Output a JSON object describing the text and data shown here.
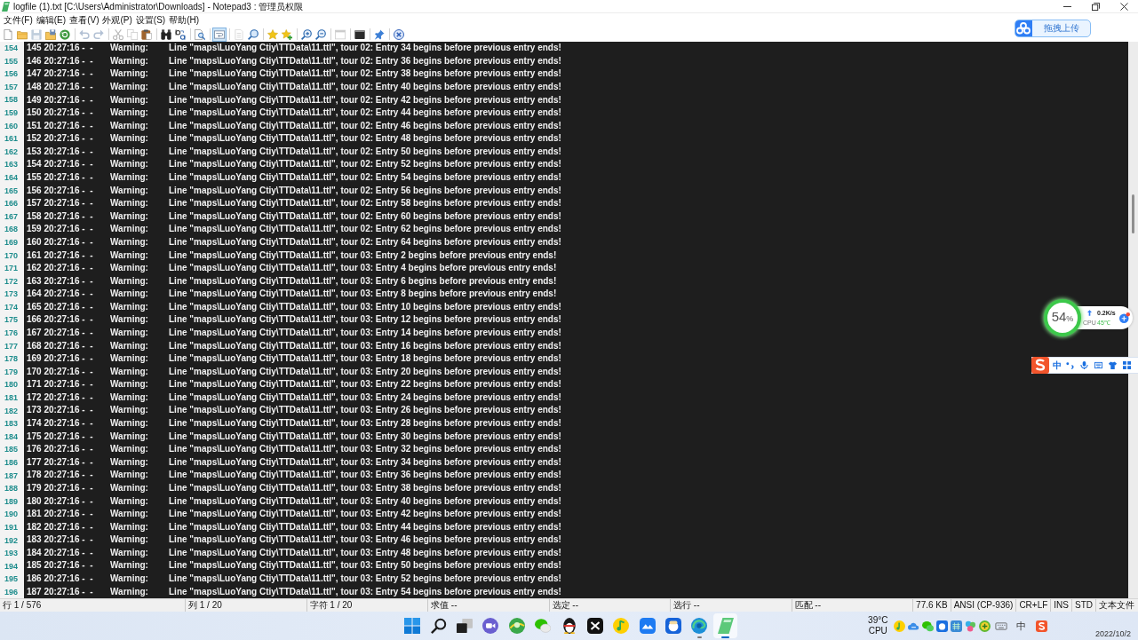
{
  "window": {
    "title": "logfile (1).txt [C:\\Users\\Administrator\\Downloads] - Notepad3 : 管理员权限"
  },
  "menu": [
    "文件(F)",
    "编辑(E)",
    "查看(V)",
    "外观(P)",
    "设置(S)",
    "帮助(H)"
  ],
  "toolbar": [
    {
      "buttons": [
        {
          "kind": "new",
          "disabled": false,
          "selected": false
        },
        {
          "kind": "open",
          "disabled": false,
          "selected": false
        },
        {
          "kind": "save",
          "disabled": true,
          "selected": false
        },
        {
          "kind": "saveas",
          "disabled": false,
          "selected": false
        },
        {
          "kind": "revert",
          "disabled": false,
          "selected": false
        }
      ]
    },
    {
      "buttons": [
        {
          "kind": "undo",
          "disabled": true,
          "selected": false
        },
        {
          "kind": "redo",
          "disabled": true,
          "selected": false
        }
      ]
    },
    {
      "buttons": [
        {
          "kind": "cut",
          "disabled": true,
          "selected": false
        },
        {
          "kind": "copy",
          "disabled": true,
          "selected": false
        },
        {
          "kind": "paste",
          "disabled": false,
          "selected": false
        }
      ]
    },
    {
      "buttons": [
        {
          "kind": "find",
          "disabled": false,
          "selected": false
        },
        {
          "kind": "replace",
          "disabled": false,
          "selected": false
        }
      ]
    },
    {
      "buttons": [
        {
          "kind": "lookup",
          "disabled": false,
          "selected": false
        }
      ]
    },
    {
      "buttons": [
        {
          "kind": "wrap",
          "disabled": false,
          "selected": true
        }
      ]
    },
    {
      "buttons": [
        {
          "kind": "page",
          "disabled": true,
          "selected": false
        },
        {
          "kind": "search",
          "disabled": false,
          "selected": false
        }
      ]
    },
    {
      "buttons": [
        {
          "kind": "star",
          "disabled": false,
          "selected": false
        },
        {
          "kind": "starplus",
          "disabled": false,
          "selected": false
        }
      ]
    },
    {
      "buttons": [
        {
          "kind": "zoomin",
          "disabled": false,
          "selected": false
        },
        {
          "kind": "zoomout",
          "disabled": false,
          "selected": false
        }
      ]
    },
    {
      "buttons": [
        {
          "kind": "window",
          "disabled": true,
          "selected": false
        }
      ]
    },
    {
      "buttons": [
        {
          "kind": "terminal",
          "disabled": false,
          "selected": false
        }
      ]
    },
    {
      "buttons": [
        {
          "kind": "pin",
          "disabled": false,
          "selected": false
        }
      ]
    },
    {
      "buttons": [
        {
          "kind": "close",
          "disabled": false,
          "selected": false
        }
      ]
    }
  ],
  "upload_button": {
    "label": "拖拽上传"
  },
  "editor": {
    "rows": [
      {
        "line_number": "154",
        "head": "145 20:27:16 -  -",
        "severity": "Warning:",
        "message": "Line \"maps\\LuoYang Ctiy\\TTData\\11.ttl\", tour 02: Entry 34 begins before previous entry ends!"
      },
      {
        "line_number": "155",
        "head": "146 20:27:16 -  -",
        "severity": "Warning:",
        "message": "Line \"maps\\LuoYang Ctiy\\TTData\\11.ttl\", tour 02: Entry 36 begins before previous entry ends!"
      },
      {
        "line_number": "156",
        "head": "147 20:27:16 -  -",
        "severity": "Warning:",
        "message": "Line \"maps\\LuoYang Ctiy\\TTData\\11.ttl\", tour 02: Entry 38 begins before previous entry ends!"
      },
      {
        "line_number": "157",
        "head": "148 20:27:16 -  -",
        "severity": "Warning:",
        "message": "Line \"maps\\LuoYang Ctiy\\TTData\\11.ttl\", tour 02: Entry 40 begins before previous entry ends!"
      },
      {
        "line_number": "158",
        "head": "149 20:27:16 -  -",
        "severity": "Warning:",
        "message": "Line \"maps\\LuoYang Ctiy\\TTData\\11.ttl\", tour 02: Entry 42 begins before previous entry ends!"
      },
      {
        "line_number": "159",
        "head": "150 20:27:16 -  -",
        "severity": "Warning:",
        "message": "Line \"maps\\LuoYang Ctiy\\TTData\\11.ttl\", tour 02: Entry 44 begins before previous entry ends!"
      },
      {
        "line_number": "160",
        "head": "151 20:27:16 -  -",
        "severity": "Warning:",
        "message": "Line \"maps\\LuoYang Ctiy\\TTData\\11.ttl\", tour 02: Entry 46 begins before previous entry ends!"
      },
      {
        "line_number": "161",
        "head": "152 20:27:16 -  -",
        "severity": "Warning:",
        "message": "Line \"maps\\LuoYang Ctiy\\TTData\\11.ttl\", tour 02: Entry 48 begins before previous entry ends!"
      },
      {
        "line_number": "162",
        "head": "153 20:27:16 -  -",
        "severity": "Warning:",
        "message": "Line \"maps\\LuoYang Ctiy\\TTData\\11.ttl\", tour 02: Entry 50 begins before previous entry ends!"
      },
      {
        "line_number": "163",
        "head": "154 20:27:16 -  -",
        "severity": "Warning:",
        "message": "Line \"maps\\LuoYang Ctiy\\TTData\\11.ttl\", tour 02: Entry 52 begins before previous entry ends!"
      },
      {
        "line_number": "164",
        "head": "155 20:27:16 -  -",
        "severity": "Warning:",
        "message": "Line \"maps\\LuoYang Ctiy\\TTData\\11.ttl\", tour 02: Entry 54 begins before previous entry ends!"
      },
      {
        "line_number": "165",
        "head": "156 20:27:16 -  -",
        "severity": "Warning:",
        "message": "Line \"maps\\LuoYang Ctiy\\TTData\\11.ttl\", tour 02: Entry 56 begins before previous entry ends!"
      },
      {
        "line_number": "166",
        "head": "157 20:27:16 -  -",
        "severity": "Warning:",
        "message": "Line \"maps\\LuoYang Ctiy\\TTData\\11.ttl\", tour 02: Entry 58 begins before previous entry ends!"
      },
      {
        "line_number": "167",
        "head": "158 20:27:16 -  -",
        "severity": "Warning:",
        "message": "Line \"maps\\LuoYang Ctiy\\TTData\\11.ttl\", tour 02: Entry 60 begins before previous entry ends!"
      },
      {
        "line_number": "168",
        "head": "159 20:27:16 -  -",
        "severity": "Warning:",
        "message": "Line \"maps\\LuoYang Ctiy\\TTData\\11.ttl\", tour 02: Entry 62 begins before previous entry ends!"
      },
      {
        "line_number": "169",
        "head": "160 20:27:16 -  -",
        "severity": "Warning:",
        "message": "Line \"maps\\LuoYang Ctiy\\TTData\\11.ttl\", tour 02: Entry 64 begins before previous entry ends!"
      },
      {
        "line_number": "170",
        "head": "161 20:27:16 -  -",
        "severity": "Warning:",
        "message": "Line \"maps\\LuoYang Ctiy\\TTData\\11.ttl\", tour 03: Entry 2 begins before previous entry ends!"
      },
      {
        "line_number": "171",
        "head": "162 20:27:16 -  -",
        "severity": "Warning:",
        "message": "Line \"maps\\LuoYang Ctiy\\TTData\\11.ttl\", tour 03: Entry 4 begins before previous entry ends!"
      },
      {
        "line_number": "172",
        "head": "163 20:27:16 -  -",
        "severity": "Warning:",
        "message": "Line \"maps\\LuoYang Ctiy\\TTData\\11.ttl\", tour 03: Entry 6 begins before previous entry ends!"
      },
      {
        "line_number": "173",
        "head": "164 20:27:16 -  -",
        "severity": "Warning:",
        "message": "Line \"maps\\LuoYang Ctiy\\TTData\\11.ttl\", tour 03: Entry 8 begins before previous entry ends!"
      },
      {
        "line_number": "174",
        "head": "165 20:27:16 -  -",
        "severity": "Warning:",
        "message": "Line \"maps\\LuoYang Ctiy\\TTData\\11.ttl\", tour 03: Entry 10 begins before previous entry ends!"
      },
      {
        "line_number": "175",
        "head": "166 20:27:16 -  -",
        "severity": "Warning:",
        "message": "Line \"maps\\LuoYang Ctiy\\TTData\\11.ttl\", tour 03: Entry 12 begins before previous entry ends!"
      },
      {
        "line_number": "176",
        "head": "167 20:27:16 -  -",
        "severity": "Warning:",
        "message": "Line \"maps\\LuoYang Ctiy\\TTData\\11.ttl\", tour 03: Entry 14 begins before previous entry ends!"
      },
      {
        "line_number": "177",
        "head": "168 20:27:16 -  -",
        "severity": "Warning:",
        "message": "Line \"maps\\LuoYang Ctiy\\TTData\\11.ttl\", tour 03: Entry 16 begins before previous entry ends!"
      },
      {
        "line_number": "178",
        "head": "169 20:27:16 -  -",
        "severity": "Warning:",
        "message": "Line \"maps\\LuoYang Ctiy\\TTData\\11.ttl\", tour 03: Entry 18 begins before previous entry ends!"
      },
      {
        "line_number": "179",
        "head": "170 20:27:16 -  -",
        "severity": "Warning:",
        "message": "Line \"maps\\LuoYang Ctiy\\TTData\\11.ttl\", tour 03: Entry 20 begins before previous entry ends!"
      },
      {
        "line_number": "180",
        "head": "171 20:27:16 -  -",
        "severity": "Warning:",
        "message": "Line \"maps\\LuoYang Ctiy\\TTData\\11.ttl\", tour 03: Entry 22 begins before previous entry ends!"
      },
      {
        "line_number": "181",
        "head": "172 20:27:16 -  -",
        "severity": "Warning:",
        "message": "Line \"maps\\LuoYang Ctiy\\TTData\\11.ttl\", tour 03: Entry 24 begins before previous entry ends!"
      },
      {
        "line_number": "182",
        "head": "173 20:27:16 -  -",
        "severity": "Warning:",
        "message": "Line \"maps\\LuoYang Ctiy\\TTData\\11.ttl\", tour 03: Entry 26 begins before previous entry ends!"
      },
      {
        "line_number": "183",
        "head": "174 20:27:16 -  -",
        "severity": "Warning:",
        "message": "Line \"maps\\LuoYang Ctiy\\TTData\\11.ttl\", tour 03: Entry 28 begins before previous entry ends!"
      },
      {
        "line_number": "184",
        "head": "175 20:27:16 -  -",
        "severity": "Warning:",
        "message": "Line \"maps\\LuoYang Ctiy\\TTData\\11.ttl\", tour 03: Entry 30 begins before previous entry ends!"
      },
      {
        "line_number": "185",
        "head": "176 20:27:16 -  -",
        "severity": "Warning:",
        "message": "Line \"maps\\LuoYang Ctiy\\TTData\\11.ttl\", tour 03: Entry 32 begins before previous entry ends!"
      },
      {
        "line_number": "186",
        "head": "177 20:27:16 -  -",
        "severity": "Warning:",
        "message": "Line \"maps\\LuoYang Ctiy\\TTData\\11.ttl\", tour 03: Entry 34 begins before previous entry ends!"
      },
      {
        "line_number": "187",
        "head": "178 20:27:16 -  -",
        "severity": "Warning:",
        "message": "Line \"maps\\LuoYang Ctiy\\TTData\\11.ttl\", tour 03: Entry 36 begins before previous entry ends!"
      },
      {
        "line_number": "188",
        "head": "179 20:27:16 -  -",
        "severity": "Warning:",
        "message": "Line \"maps\\LuoYang Ctiy\\TTData\\11.ttl\", tour 03: Entry 38 begins before previous entry ends!"
      },
      {
        "line_number": "189",
        "head": "180 20:27:16 -  -",
        "severity": "Warning:",
        "message": "Line \"maps\\LuoYang Ctiy\\TTData\\11.ttl\", tour 03: Entry 40 begins before previous entry ends!"
      },
      {
        "line_number": "190",
        "head": "181 20:27:16 -  -",
        "severity": "Warning:",
        "message": "Line \"maps\\LuoYang Ctiy\\TTData\\11.ttl\", tour 03: Entry 42 begins before previous entry ends!"
      },
      {
        "line_number": "191",
        "head": "182 20:27:16 -  -",
        "severity": "Warning:",
        "message": "Line \"maps\\LuoYang Ctiy\\TTData\\11.ttl\", tour 03: Entry 44 begins before previous entry ends!"
      },
      {
        "line_number": "192",
        "head": "183 20:27:16 -  -",
        "severity": "Warning:",
        "message": "Line \"maps\\LuoYang Ctiy\\TTData\\11.ttl\", tour 03: Entry 46 begins before previous entry ends!"
      },
      {
        "line_number": "193",
        "head": "184 20:27:16 -  -",
        "severity": "Warning:",
        "message": "Line \"maps\\LuoYang Ctiy\\TTData\\11.ttl\", tour 03: Entry 48 begins before previous entry ends!"
      },
      {
        "line_number": "194",
        "head": "185 20:27:16 -  -",
        "severity": "Warning:",
        "message": "Line \"maps\\LuoYang Ctiy\\TTData\\11.ttl\", tour 03: Entry 50 begins before previous entry ends!"
      },
      {
        "line_number": "195",
        "head": "186 20:27:16 -  -",
        "severity": "Warning:",
        "message": "Line \"maps\\LuoYang Ctiy\\TTData\\11.ttl\", tour 03: Entry 52 begins before previous entry ends!"
      },
      {
        "line_number": "196",
        "head": "187 20:27:16 -  -",
        "severity": "Warning:",
        "message": "Line \"maps\\LuoYang Ctiy\\TTData\\11.ttl\", tour 03: Entry 54 begins before previous entry ends!"
      }
    ]
  },
  "system_monitor": {
    "percent": "54",
    "unit": "%",
    "net_speed": "0.2K/s",
    "cpu_label": "CPU",
    "cpu_temperature": "45℃"
  },
  "ime_toolbar": {
    "mode": "中"
  },
  "status_bar": {
    "fields": [
      "行 1 / 576",
      "列 1 / 20",
      "字符 1 / 20",
      "求值 --",
      "选定 --",
      "选行 --",
      "匹配 --"
    ],
    "info": [
      "77.6 KB",
      "ANSI (CP-936)",
      "CR+LF",
      "INS",
      "STD",
      "文本文件"
    ]
  },
  "taskbar": {
    "apps": [
      {
        "kind": "start",
        "selected": false,
        "running": false
      },
      {
        "kind": "search",
        "selected": false,
        "running": false
      },
      {
        "kind": "taskview",
        "selected": false,
        "running": false
      },
      {
        "kind": "meet",
        "selected": false,
        "running": false
      },
      {
        "kind": "sphere",
        "selected": false,
        "running": false
      },
      {
        "kind": "chat",
        "selected": false,
        "running": false
      },
      {
        "kind": "penguin",
        "selected": false,
        "running": false
      },
      {
        "kind": "crossed",
        "selected": false,
        "running": false
      },
      {
        "kind": "music",
        "selected": false,
        "running": false
      },
      {
        "kind": "mountain",
        "selected": false,
        "running": false
      },
      {
        "kind": "mascot",
        "selected": false,
        "running": false
      },
      {
        "kind": "swirl",
        "selected": false,
        "running": true
      },
      {
        "kind": "notepad",
        "selected": true,
        "running": true
      }
    ],
    "tray": {
      "temperature": "39°C",
      "sensor": "CPU",
      "items": [
        {
          "kind": "music"
        },
        {
          "kind": "cloud"
        },
        {
          "kind": "chat"
        },
        {
          "kind": "app"
        },
        {
          "kind": "grid"
        },
        {
          "kind": "shapes"
        },
        {
          "kind": "plus"
        },
        {
          "kind": "keyboard"
        },
        {
          "kind": "text",
          "label": "中"
        },
        {
          "kind": "slogo"
        }
      ],
      "date": "2022/10/2"
    }
  }
}
